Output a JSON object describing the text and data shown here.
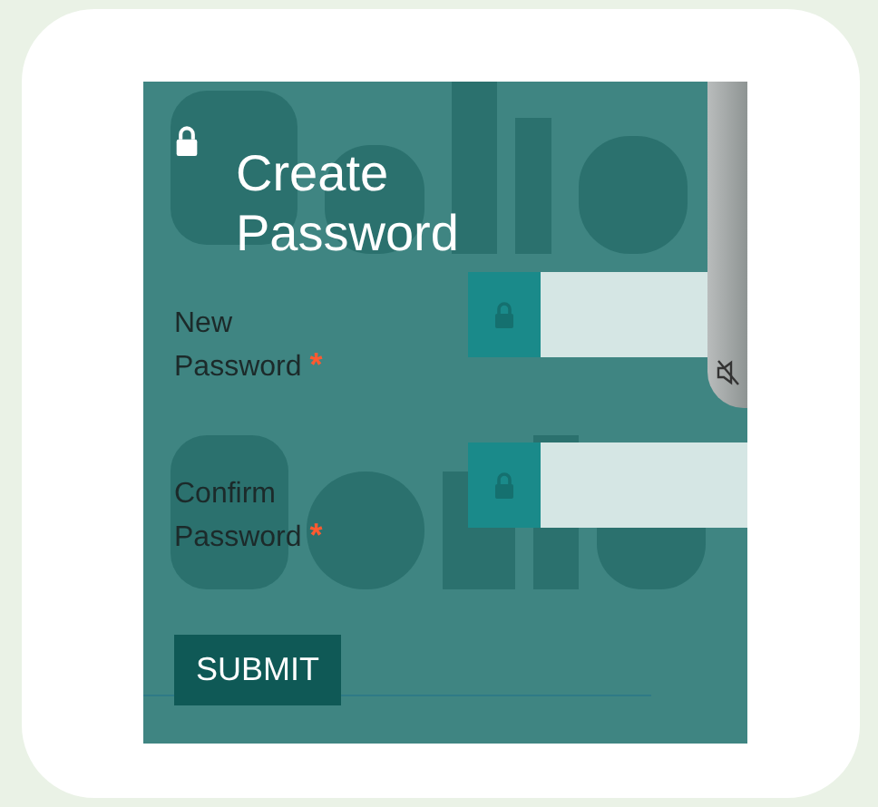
{
  "title": "Create Password",
  "fields": [
    {
      "label": "New Password",
      "required": true,
      "required_mark": "*"
    },
    {
      "label": "Confirm Password",
      "required": true,
      "required_mark": "*"
    }
  ],
  "submit": "SUBMIT",
  "side_panel": {
    "muted": true
  }
}
